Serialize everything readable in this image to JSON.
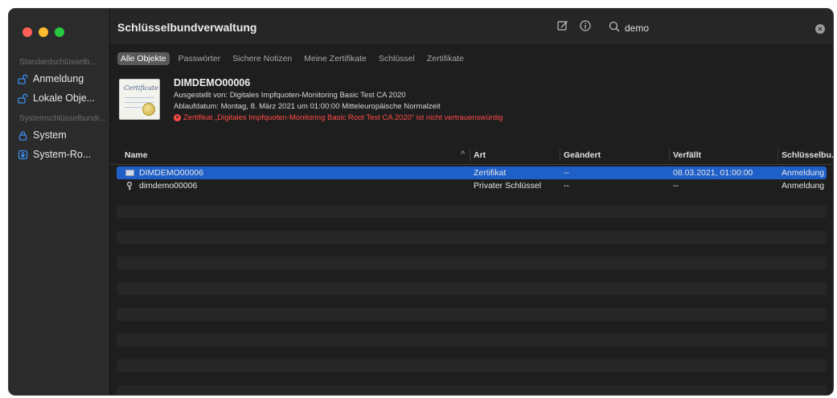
{
  "window": {
    "title": "Schlüsselbundverwaltung"
  },
  "sidebar": {
    "section_default": "Standardschlüsselb...",
    "default_items": [
      {
        "label": "Anmeldung",
        "icon": "lock-open-icon"
      },
      {
        "label": "Lokale Obje...",
        "icon": "lock-open-icon"
      }
    ],
    "section_system": "Systemschlüsselbundr...",
    "system_items": [
      {
        "label": "System",
        "icon": "lock-icon"
      },
      {
        "label": "System-Ro...",
        "icon": "cabinet-lock-icon"
      }
    ]
  },
  "toolbar": {
    "search_value": "demo",
    "compose_icon": "compose-icon",
    "info_icon": "info-icon",
    "search_icon": "search-icon",
    "clear_icon": "clear-icon"
  },
  "tabs": [
    {
      "label": "Alle Objekte",
      "active": true
    },
    {
      "label": "Passwörter",
      "active": false
    },
    {
      "label": "Sichere Notizen",
      "active": false
    },
    {
      "label": "Meine Zertifikate",
      "active": false
    },
    {
      "label": "Schlüssel",
      "active": false
    },
    {
      "label": "Zertifikate",
      "active": false
    }
  ],
  "detail": {
    "title": "DIMDEMO00006",
    "issued_by": "Ausgestellt von: Digitales Impfquoten-Monitoring Basic Test CA 2020",
    "expires": "Ablaufdatum: Montag, 8. März 2021 um 01:00:00 Mitteleuropäische Normalzeit",
    "warning": "Zertifikat „Digitales Impfquoten-Monitoring Basic Root Test CA 2020“ ist nicht vertrauenswürdig",
    "cert_script": "Certificate",
    "cert_sub": "Standard"
  },
  "table": {
    "columns": [
      "Name",
      "Art",
      "Geändert",
      "Verfällt",
      "Schlüsselbu..."
    ],
    "sort_indicator": "^",
    "rows": [
      {
        "name": "DIMDEMO00006",
        "icon": "certificate-icon",
        "art": "Zertifikat",
        "geaendert": "--",
        "verfaellt": "08.03.2021, 01:00:00",
        "schluesselbund": "Anmeldung",
        "selected": true
      },
      {
        "name": "dimdemo00006",
        "icon": "key-icon",
        "art": "Privater Schlüssel",
        "geaendert": "--",
        "verfaellt": "--",
        "schluesselbund": "Anmeldung",
        "selected": false
      }
    ]
  },
  "colors": {
    "selection": "#1f5fc8",
    "warning": "#ff4b45",
    "window_bg": "#1e1e1e",
    "sidebar_bg": "#2b2b2c",
    "sidebar_icon": "#3b8ef0"
  }
}
